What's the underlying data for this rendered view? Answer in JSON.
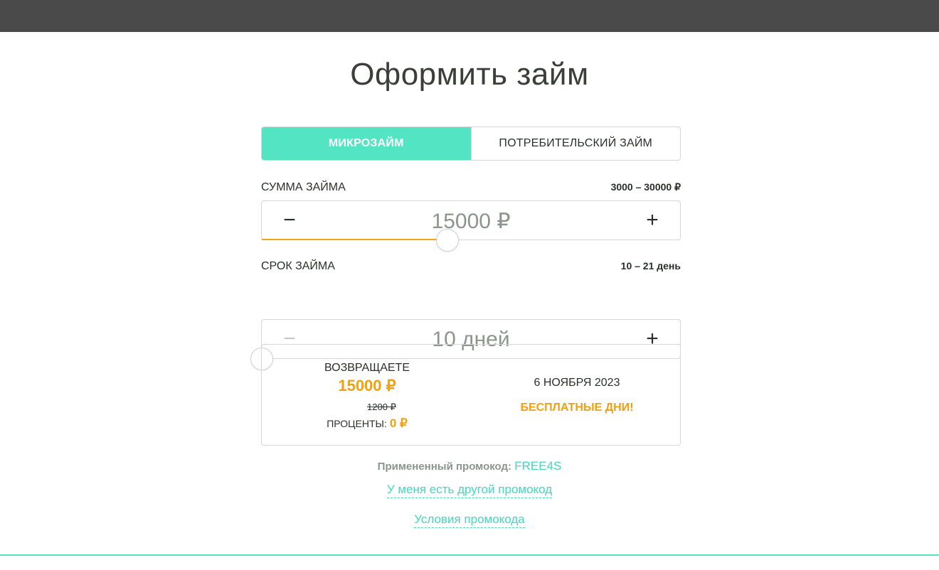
{
  "page": {
    "title": "Оформить займ"
  },
  "tabs": [
    {
      "label": "МИКРОЗАЙМ",
      "active": true
    },
    {
      "label": "ПОТРЕБИТЕЛЬСКИЙ ЗАЙМ",
      "active": false
    }
  ],
  "amount": {
    "label": "СУММА ЗАЙМА",
    "range": "3000 – 30000 ₽",
    "value": "15000 ₽",
    "minus": "−",
    "plus": "+",
    "min": 3000,
    "max": 30000,
    "current": 15000
  },
  "term": {
    "label": "СРОК ЗАЙМА",
    "range": "10 – 21 день",
    "value": "10 дней",
    "minus": "−",
    "plus": "+",
    "min": 10,
    "max": 21,
    "current": 10
  },
  "summary": {
    "return_label": "ВОЗВРАЩАЕТЕ",
    "return_amount": "15000 ₽",
    "old_interest": "1200 ₽",
    "interest_label": "ПРОЦЕНТЫ:",
    "interest_value": "0 ₽",
    "date": "6 НОЯБРЯ 2023",
    "free_days": "БЕСПЛАТНЫЕ ДНИ!"
  },
  "promo": {
    "applied_label": "Примененный промокод:",
    "code": "FREE4S",
    "other_link": "У меня есть другой промокод",
    "terms_link": "Условия промокода"
  },
  "colors": {
    "accent": "#53e4c3",
    "orange": "#f0a010",
    "topbar": "#4a4a4a"
  }
}
